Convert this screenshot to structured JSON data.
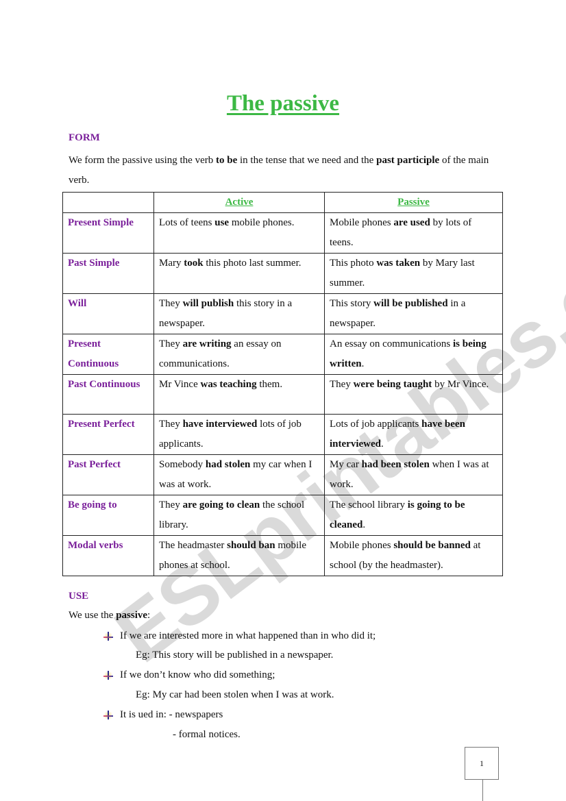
{
  "document": {
    "title": "The passive",
    "form_heading": "FORM",
    "intro": {
      "part1": " We form the passive using the verb ",
      "bold1": "to be",
      "part2": " in the tense that we need and the ",
      "bold2": "past participle",
      "part3": " of the main verb."
    },
    "table": {
      "headers": [
        "",
        "Active",
        "Passive"
      ],
      "rows": [
        {
          "tense": "Present Simple",
          "active": {
            "pre": "Lots of teens ",
            "bold": "use",
            "post": " mobile phones."
          },
          "passive": {
            "pre": "Mobile phones ",
            "bold": "are used",
            "post": " by lots of teens."
          }
        },
        {
          "tense": "Past Simple",
          "active": {
            "pre": "Mary ",
            "bold": "took",
            "post": " this photo last summer."
          },
          "passive": {
            "pre": "This photo ",
            "bold": "was taken",
            "post": " by Mary last summer."
          }
        },
        {
          "tense": "Will",
          "active": {
            "pre": "They ",
            "bold": "will publish",
            "post": " this story in a newspaper."
          },
          "passive": {
            "pre": "This story ",
            "bold": "will be published",
            "post": " in a newspaper."
          }
        },
        {
          "tense": "Present Continuous",
          "active": {
            "pre": "They ",
            "bold": "are writing",
            "post": " an essay on communications."
          },
          "passive": {
            "pre": "An essay on communications ",
            "bold": "is being written",
            "post": "."
          }
        },
        {
          "tense": "Past Continuous",
          "active": {
            "pre": "Mr Vince ",
            "bold": "was teaching",
            "post": " them."
          },
          "passive": {
            "pre": "They ",
            "bold": "were being taught",
            "post": " by Mr Vince."
          }
        },
        {
          "tense": "Present Perfect",
          "active": {
            "pre": "They ",
            "bold": "have interviewed",
            "post": " lots of job applicants."
          },
          "passive": {
            "pre": "Lots of job applicants ",
            "bold": "have been interviewed",
            "post": "."
          }
        },
        {
          "tense": "Past Perfect",
          "active": {
            "pre": "Somebody ",
            "bold": "had stolen",
            "post": " my car when I was at work."
          },
          "passive": {
            "pre": "My car ",
            "bold": "had been stolen",
            "post": " when I was at work."
          }
        },
        {
          "tense": "Be going to",
          "active": {
            "pre": "They ",
            "bold": "are going to clean",
            "post": " the school library."
          },
          "passive": {
            "pre": "The school library ",
            "bold": "is going to be cleaned",
            "post": "."
          }
        },
        {
          "tense": "Modal verbs",
          "active": {
            "pre": "The headmaster ",
            "bold": "should ban",
            "post": " mobile phones at school."
          },
          "passive": {
            "pre": "Mobile phones ",
            "bold": "should be banned",
            "post": " at school (by the headmaster)."
          }
        }
      ]
    },
    "use_heading": "USE",
    "use_intro": {
      "pre": "We use the ",
      "bold": "passive",
      "post": ":"
    },
    "use_items": [
      {
        "text": "If we are interested more in what happened than in who did it;",
        "example": "Eg: This story will be published in a newspaper."
      },
      {
        "text": "If we don’t know who did something;",
        "example": "Eg: My car had been stolen when I was at work."
      },
      {
        "text": "It is ued in: - newspapers",
        "sub": "- formal notices."
      }
    ],
    "bullet_icon": "arrow-down-bullet-icon",
    "page_number": "1",
    "watermark": "ESLprintables.com"
  },
  "colors": {
    "title_green": "#3cb844",
    "heading_purple": "#7a1f9a"
  }
}
